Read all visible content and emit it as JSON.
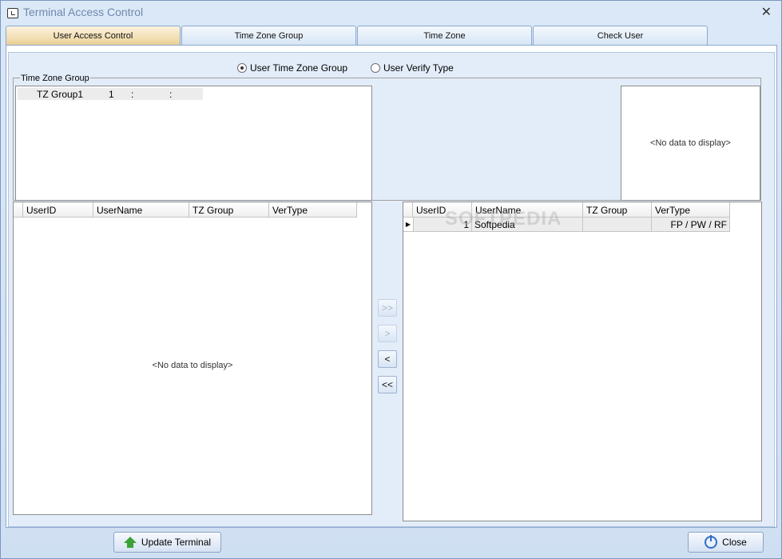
{
  "window": {
    "title": "Terminal Access Control",
    "close_glyph": "✕"
  },
  "tabs": [
    {
      "label": "User Access Control",
      "active": true
    },
    {
      "label": "Time Zone Group",
      "active": false
    },
    {
      "label": "Time Zone",
      "active": false
    },
    {
      "label": "Check User",
      "active": false
    }
  ],
  "options": {
    "radio1": {
      "label": "User Time Zone Group",
      "checked": true
    },
    "radio2": {
      "label": "User Verify Type",
      "checked": false
    }
  },
  "time_zone_group": {
    "label": "Time Zone Group",
    "row": {
      "name": "TZ Group1",
      "value": "1",
      "sep1": ":",
      "sep2": ":"
    }
  },
  "right_top_panel": {
    "empty_text": "<No data to display>"
  },
  "left_grid": {
    "columns": [
      "UserID",
      "UserName",
      "TZ Group",
      "VerType"
    ],
    "empty_text": "<No data to display>"
  },
  "right_grid": {
    "columns": [
      "UserID",
      "UserName",
      "TZ Group",
      "VerType"
    ],
    "rows": [
      {
        "userid": "1",
        "username": "Softpedia",
        "tzgroup": "",
        "vertype": "FP / PW / RF"
      }
    ]
  },
  "move_buttons": {
    "all_right": ">>",
    "right": ">",
    "left": "<",
    "all_left": "<<"
  },
  "watermark": "SOFTPEDIA",
  "footer": {
    "update_label": "Update Terminal",
    "close_label": "Close"
  }
}
